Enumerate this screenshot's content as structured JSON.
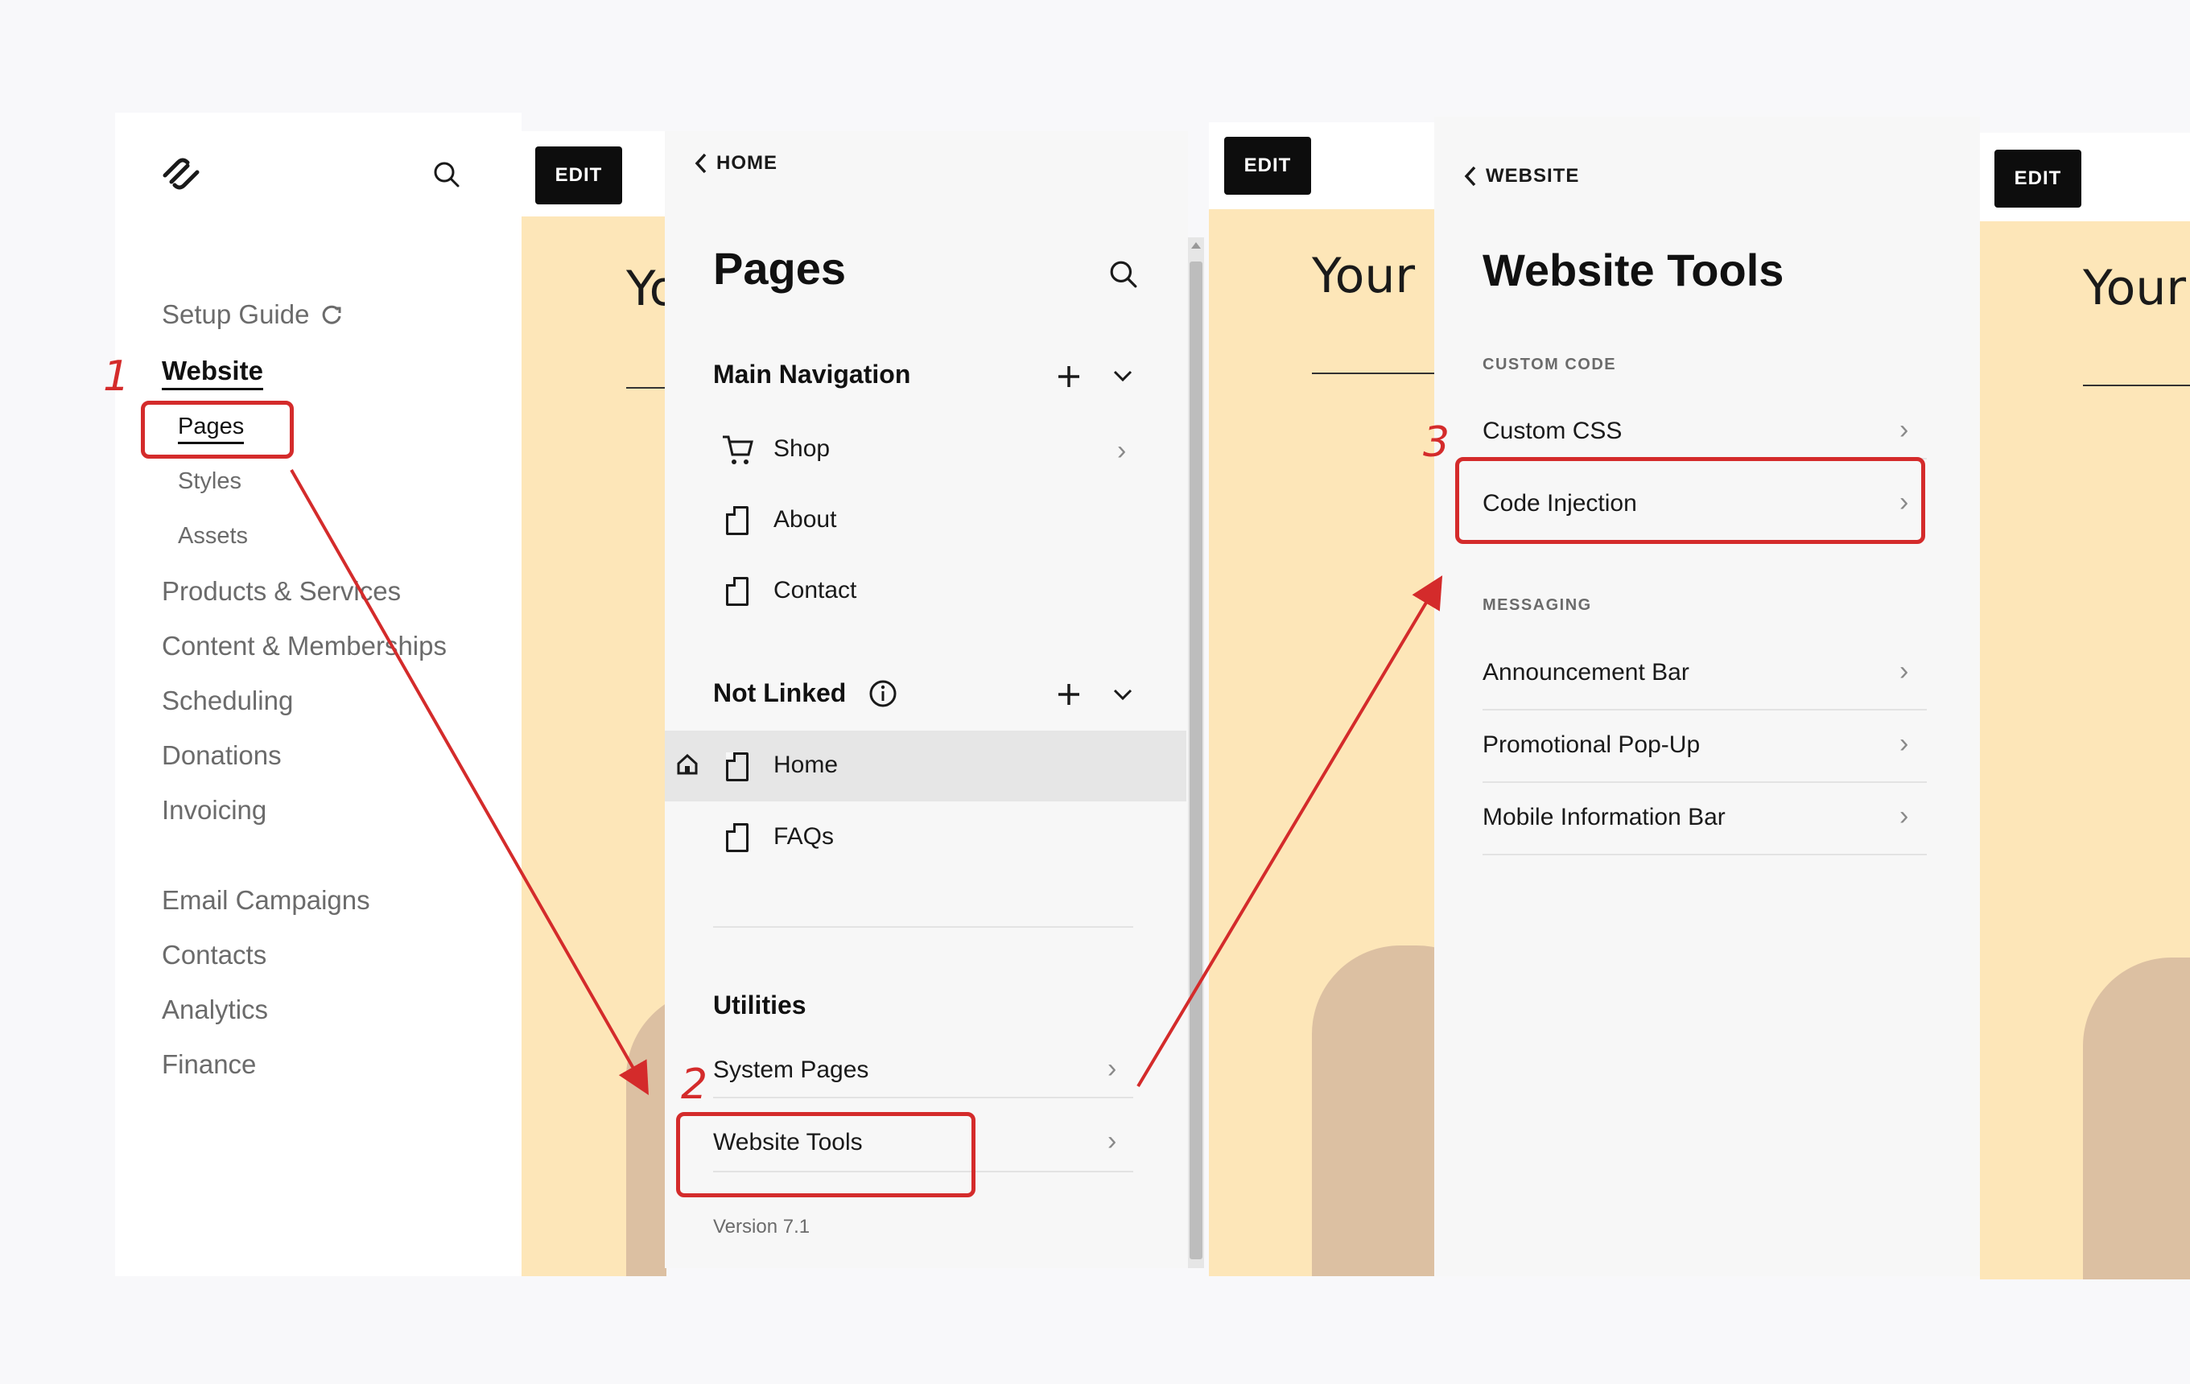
{
  "colors": {
    "accent_red": "#d42b2b",
    "hero_background": "#fde6b8",
    "arch": "#dcc0a2",
    "edit_button": "#0d0d0d"
  },
  "sidebar": {
    "logo_icon": "squarespace-logo-icon",
    "search_icon": "search-icon",
    "items": [
      {
        "label": "Setup Guide",
        "icon": "refresh-icon"
      },
      {
        "label": "Website",
        "active": true
      },
      {
        "label": "Pages",
        "sub": true
      },
      {
        "label": "Styles",
        "sub": true
      },
      {
        "label": "Assets",
        "sub": true
      },
      {
        "label": "Products & Services"
      },
      {
        "label": "Content & Memberships"
      },
      {
        "label": "Scheduling"
      },
      {
        "label": "Donations"
      },
      {
        "label": "Invoicing"
      },
      {
        "label": "Email Campaigns"
      },
      {
        "label": "Contacts"
      },
      {
        "label": "Analytics"
      },
      {
        "label": "Finance"
      }
    ]
  },
  "preview": {
    "edit_label": "EDIT",
    "hero_partial_1": "Yo",
    "hero_partial_2": "Your",
    "hero_partial_3": "Your"
  },
  "pages_panel": {
    "back_label": "HOME",
    "title": "Pages",
    "main_navigation": {
      "heading": "Main Navigation",
      "items": [
        "Shop",
        "About",
        "Contact"
      ]
    },
    "not_linked": {
      "heading": "Not Linked",
      "items": [
        "Home",
        "FAQs"
      ]
    },
    "utilities": {
      "heading": "Utilities",
      "items": [
        "System Pages",
        "Website Tools"
      ]
    },
    "version": "Version 7.1"
  },
  "tools_panel": {
    "back_label": "WEBSITE",
    "title": "Website Tools",
    "custom_code": {
      "caption": "CUSTOM CODE",
      "items": [
        "Custom CSS",
        "Code Injection"
      ]
    },
    "messaging": {
      "caption": "MESSAGING",
      "items": [
        "Announcement Bar",
        "Promotional Pop-Up",
        "Mobile Information Bar"
      ]
    }
  },
  "annotations": {
    "step1": "1",
    "step2": "2",
    "step3": "3"
  }
}
